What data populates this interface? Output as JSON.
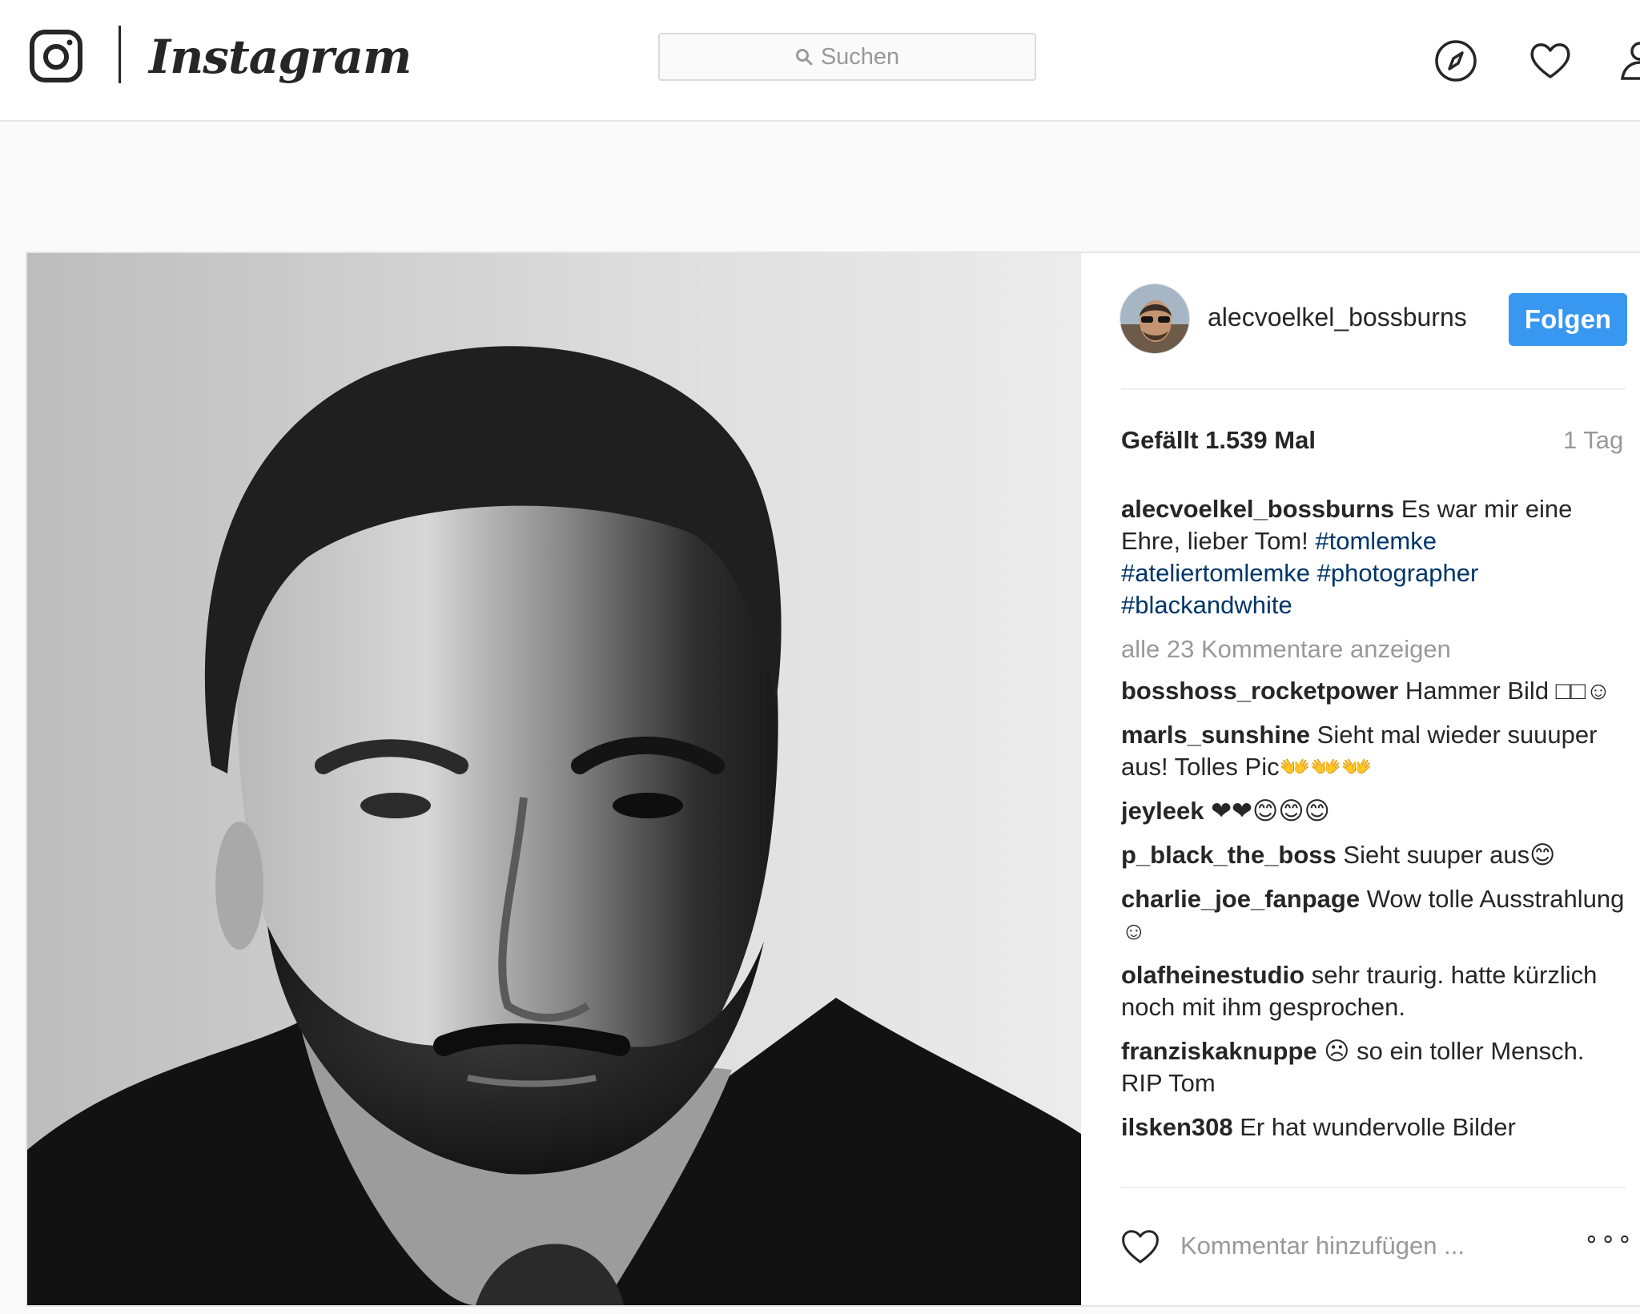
{
  "nav": {
    "wordmark": "Instagram",
    "search_placeholder": "Suchen"
  },
  "post": {
    "author": "alecvoelkel_bossburns",
    "follow_label": "Folgen",
    "likes": "Gefällt 1.539 Mal",
    "time": "1 Tag",
    "caption": {
      "user": "alecvoelkel_bossburns",
      "text": "Es war mir eine Ehre, lieber Tom!",
      "tags": [
        "#tomlemke",
        "#ateliertomlemke",
        "#photographer",
        "#blackandwhite"
      ]
    },
    "view_all": "alle 23 Kommentare anzeigen",
    "comments": [
      {
        "user": "bosshoss_rocketpower",
        "text": "Hammer Bild □□☺"
      },
      {
        "user": "marls_sunshine",
        "text": "Sieht mal wieder suuuper aus! Tolles Pic👐👐👐"
      },
      {
        "user": "jeyleek",
        "text": "❤❤😊😊😊"
      },
      {
        "user": "p_black_the_boss",
        "text": "Sieht suuper aus😊"
      },
      {
        "user": "charlie_joe_fanpage",
        "text": "Wow tolle Ausstrahlung ☺"
      },
      {
        "user": "olafheinestudio",
        "text": "sehr traurig. hatte kürzlich noch mit ihm gesprochen."
      },
      {
        "user": "franziskaknuppe",
        "text": "☹ so ein toller Mensch. RIP Tom"
      },
      {
        "user": "ilsken308",
        "text": "Er hat wundervolle Bilder"
      }
    ],
    "add_comment_placeholder": "Kommentar hinzufügen ...",
    "more_label": "∘∘∘"
  }
}
